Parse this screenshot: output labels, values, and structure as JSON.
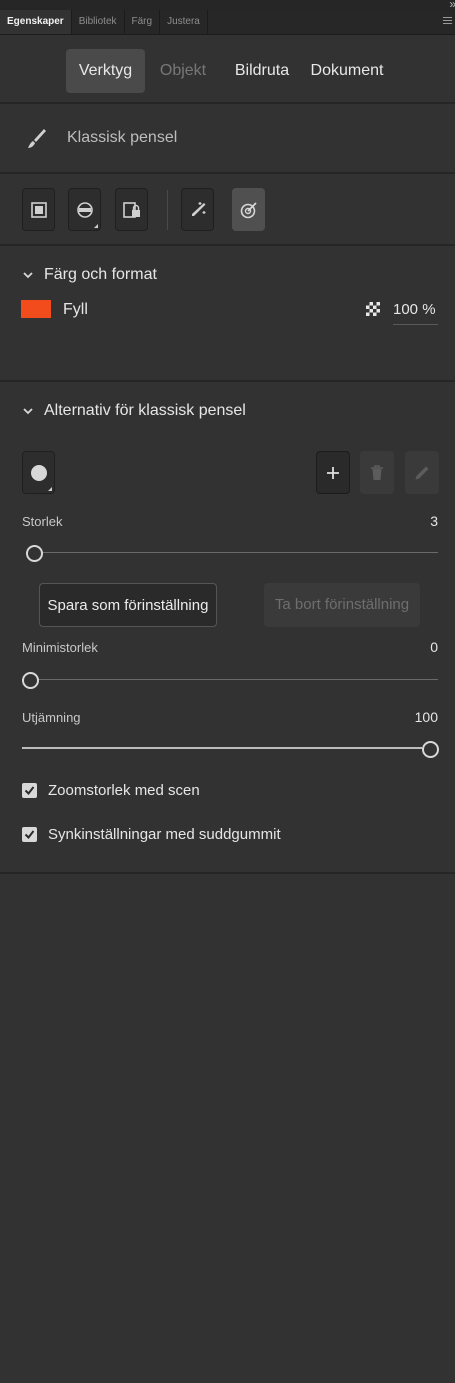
{
  "panel_tabs": [
    {
      "label": "Egenskaper",
      "active": true
    },
    {
      "label": "Bibliotek",
      "active": false
    },
    {
      "label": "Färg",
      "active": false
    },
    {
      "label": "Justera",
      "active": false
    }
  ],
  "collapse_mark": "»",
  "mode_tabs": [
    {
      "label": "Verktyg",
      "active": true
    },
    {
      "label": "Objekt",
      "disabled": true
    },
    {
      "label": "Bildruta"
    },
    {
      "label": "Dokument"
    }
  ],
  "tool": {
    "name": "Klassisk pensel",
    "icon": "brush-icon"
  },
  "tool_icons": [
    "object-drawing-icon",
    "snap-icon",
    "lock-fill-icon",
    "pressure-icon",
    "tilt-icon"
  ],
  "color_section": {
    "title": "Färg och format",
    "fill_label": "Fyll",
    "fill_color": "#f24b1c",
    "alpha": "100 %"
  },
  "brush_section": {
    "title": "Alternativ för klassisk pensel",
    "size": {
      "label": "Storlek",
      "value": "3",
      "fraction": 0.0
    },
    "save_preset": "Spara som förinställning",
    "delete_preset": "Ta bort förinställning",
    "min_size": {
      "label": "Minimistorlek",
      "value": "0",
      "fraction": 0.0
    },
    "smoothing": {
      "label": "Utjämning",
      "value": "100",
      "fraction": 1.0
    },
    "checkboxes": [
      {
        "label": "Zoomstorlek med scen",
        "checked": true
      },
      {
        "label": "Synkinställningar med suddgummit",
        "checked": true
      }
    ]
  }
}
